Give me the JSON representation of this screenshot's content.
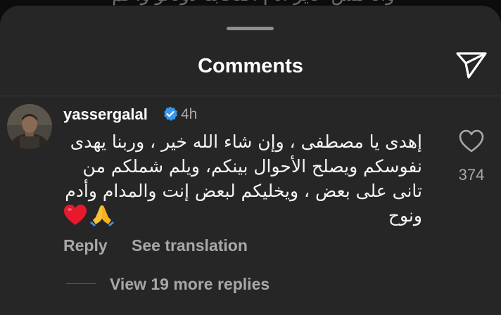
{
  "background": {
    "overlay_text": "وانا مش عايز ادم اصحابنا دوناتو واحم"
  },
  "sheet": {
    "title": "Comments",
    "share_icon": "send-icon"
  },
  "comment": {
    "username": "yassergalal",
    "verified": true,
    "time": "4h",
    "lines": [
      "إهدى يا مصطفى ، وإن شاء الله خير ، وربنا يهدى",
      "نفوسكم ويصلح الأحوال بينكم، ويلم شملكم من",
      "تانى على بعض ، ويخليكم لبعض إنت والمدام وأدم",
      "ونوح"
    ],
    "emojis": [
      "heart-emoji",
      "folded-hands-emoji"
    ],
    "like_icon": "heart-outline-icon",
    "like_count": "374",
    "reply_label": "Reply",
    "translate_label": "See translation",
    "view_replies_label": "View 19 more replies"
  },
  "colors": {
    "sheet_bg": "#262626",
    "secondary_text": "#a8a8a8",
    "verified_blue": "#3897f0"
  }
}
